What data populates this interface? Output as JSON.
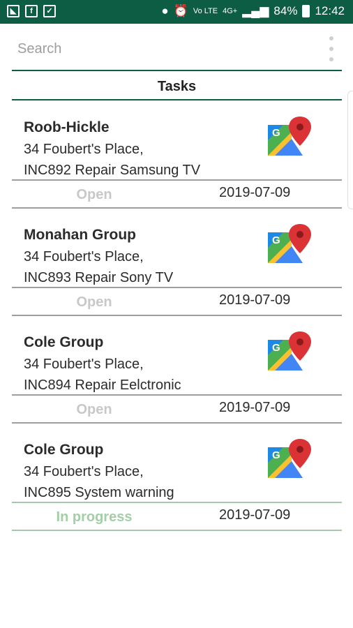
{
  "status_bar": {
    "network_label": "Vo LTE",
    "signal_label": "4G+",
    "battery": "84%",
    "time": "12:42"
  },
  "search": {
    "placeholder": "Search"
  },
  "header": {
    "title": "Tasks"
  },
  "tasks": [
    {
      "name": "Roob-Hickle",
      "address": "34 Foubert's Place,",
      "description": "INC892 Repair Samsung TV",
      "status": "Open",
      "date": "2019-07-09"
    },
    {
      "name": "Monahan Group",
      "address": "34 Foubert's Place,",
      "description": "INC893 Repair Sony TV",
      "status": "Open",
      "date": "2019-07-09"
    },
    {
      "name": "Cole Group",
      "address": "34 Foubert's Place,",
      "description": "INC894 Repair Eelctronic",
      "status": "Open",
      "date": "2019-07-09"
    },
    {
      "name": "Cole Group",
      "address": "34 Foubert's Place,",
      "description": "INC895 System warning",
      "status": "In progress",
      "date": "2019-07-09"
    }
  ],
  "icons": {
    "map": "google-maps-icon"
  },
  "colors": {
    "status_bar": "#0d5c44",
    "accent": "#0d5c44",
    "open_status": "#c8c8c8",
    "in_progress_status": "#a3cea6"
  }
}
